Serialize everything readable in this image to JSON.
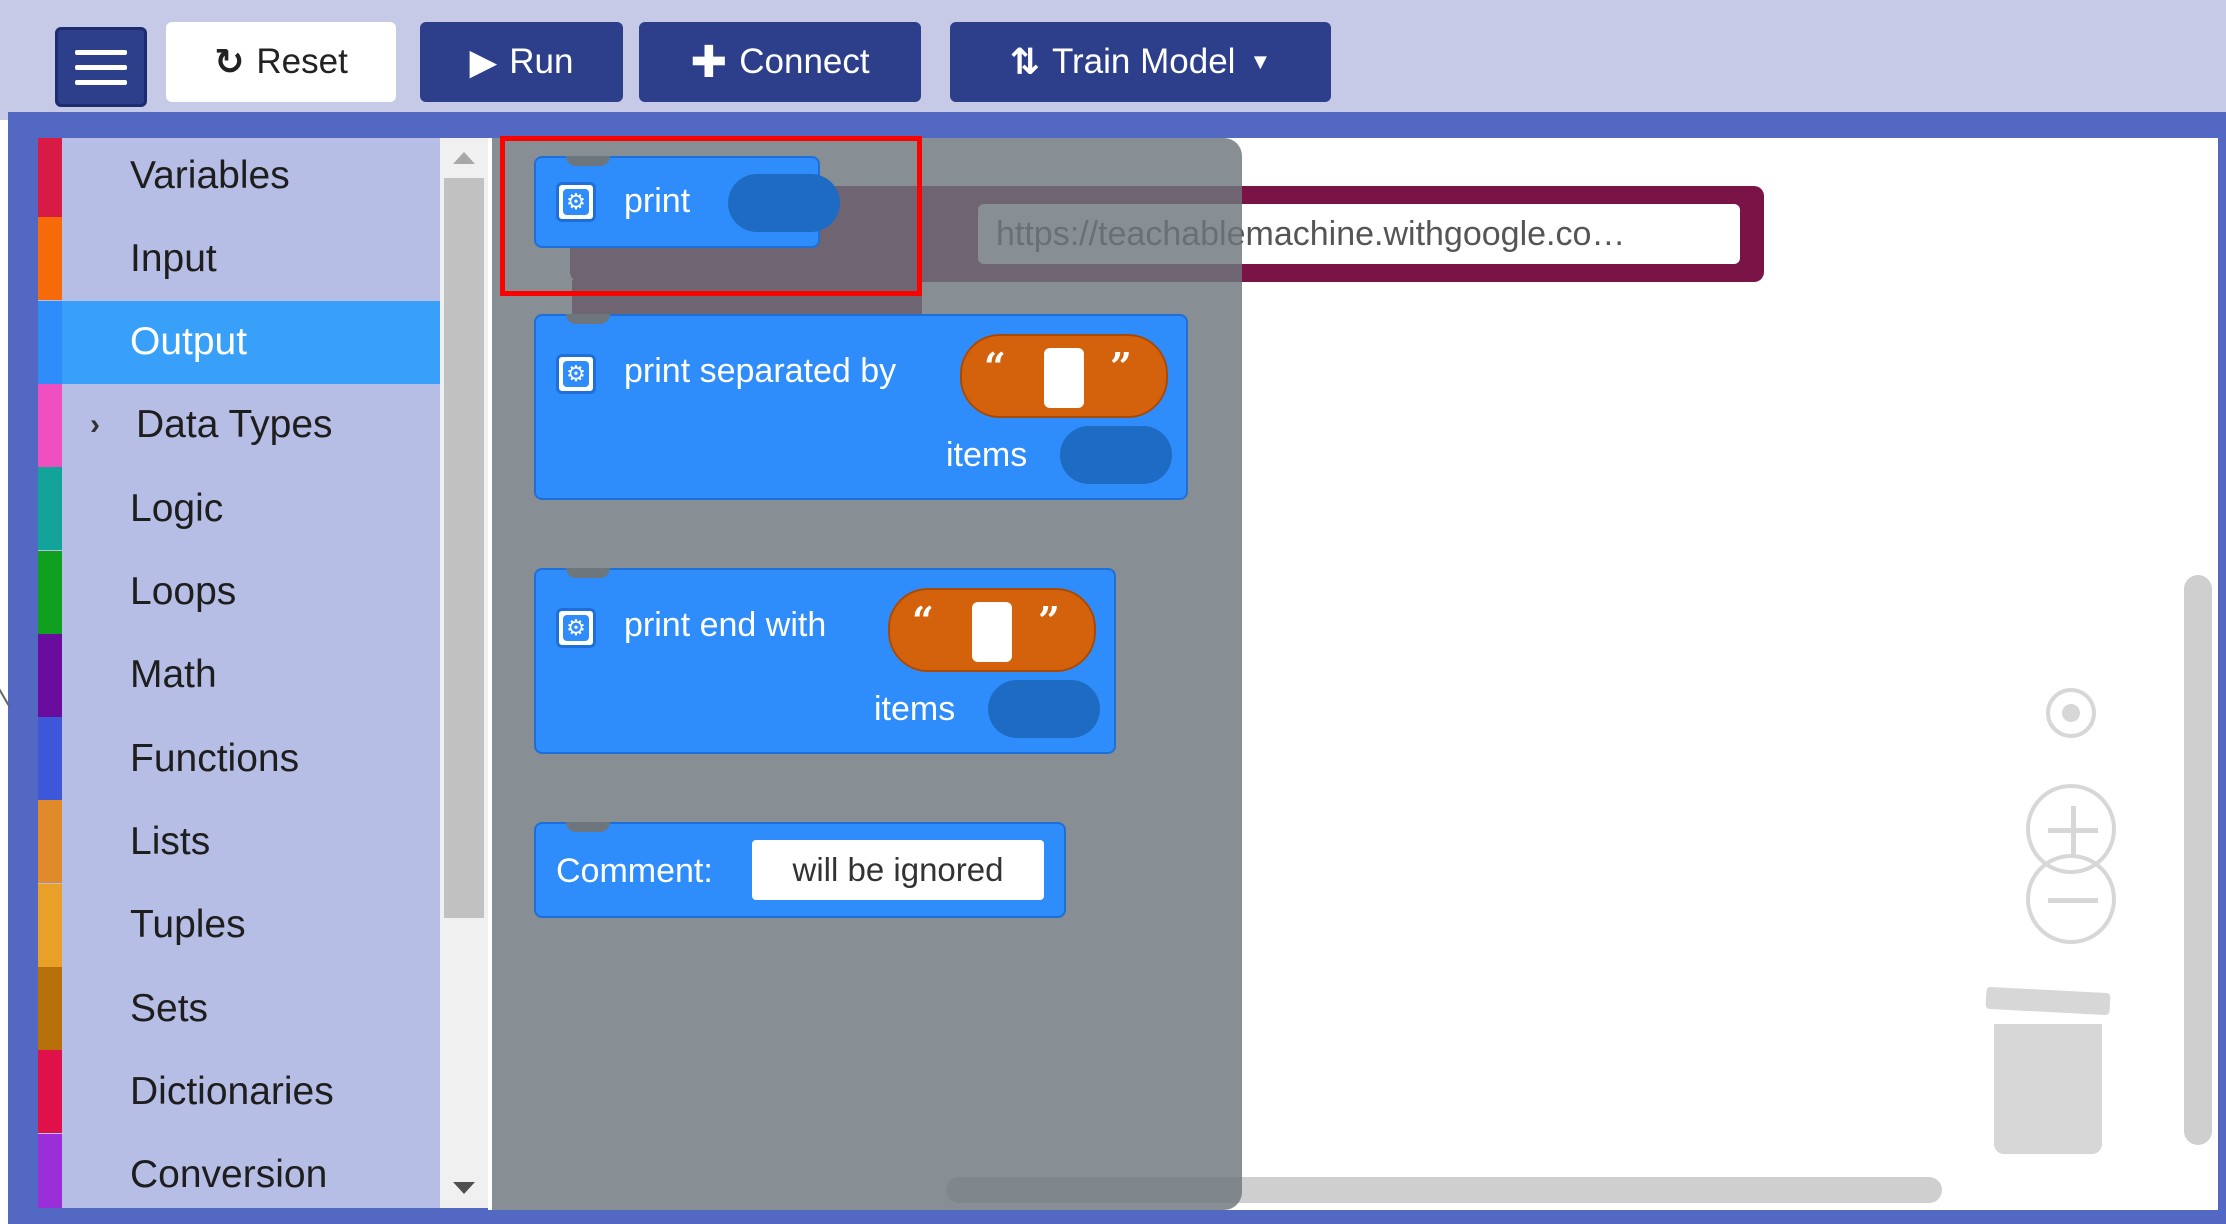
{
  "toolbar": {
    "reset_label": "Reset",
    "run_label": "Run",
    "connect_label": "Connect",
    "train_label": "Train Model"
  },
  "categories": [
    {
      "label": "Variables",
      "color": "#d81b44",
      "selected": false
    },
    {
      "label": "Input",
      "color": "#f66a0a",
      "selected": false
    },
    {
      "label": "Output",
      "color": "#2f8cfb",
      "selected": true
    },
    {
      "label": "Data Types",
      "color": "#f04fc1",
      "selected": false,
      "expandable": true
    },
    {
      "label": "Logic",
      "color": "#12a39a",
      "selected": false
    },
    {
      "label": "Loops",
      "color": "#10a020",
      "selected": false
    },
    {
      "label": "Math",
      "color": "#6a0d9e",
      "selected": false
    },
    {
      "label": "Functions",
      "color": "#3d57d8",
      "selected": false
    },
    {
      "label": "Lists",
      "color": "#e08a2c",
      "selected": false
    },
    {
      "label": "Tuples",
      "color": "#e8a028",
      "selected": false
    },
    {
      "label": "Sets",
      "color": "#b8700a",
      "selected": false
    },
    {
      "label": "Dictionaries",
      "color": "#e0104a",
      "selected": false
    },
    {
      "label": "Conversion",
      "color": "#9a2ed8",
      "selected": false
    }
  ],
  "flyout": {
    "print_label": "print",
    "print_sep_label": "print separated by",
    "print_sep_items": "items",
    "print_end_label": "print end with",
    "print_end_items": "items",
    "comment_label": "Comment:",
    "comment_value": "will be ignored"
  },
  "workspace": {
    "url_value": "https://teachablemachine.withgoogle.co…"
  },
  "colors": {
    "toolbar_bg": "#c6cae7",
    "button_dark": "#2d3f8a",
    "block_blue": "#2f8cfb",
    "string_orange": "#d4620c",
    "highlight_red": "#ff0000",
    "background_block": "#7a1446"
  },
  "icons": {
    "menu": "hamburger-icon",
    "reset": "refresh-icon",
    "run": "play-icon",
    "connect": "plus-icon",
    "train": "retweet-icon",
    "dropdown": "caret-down-icon"
  }
}
